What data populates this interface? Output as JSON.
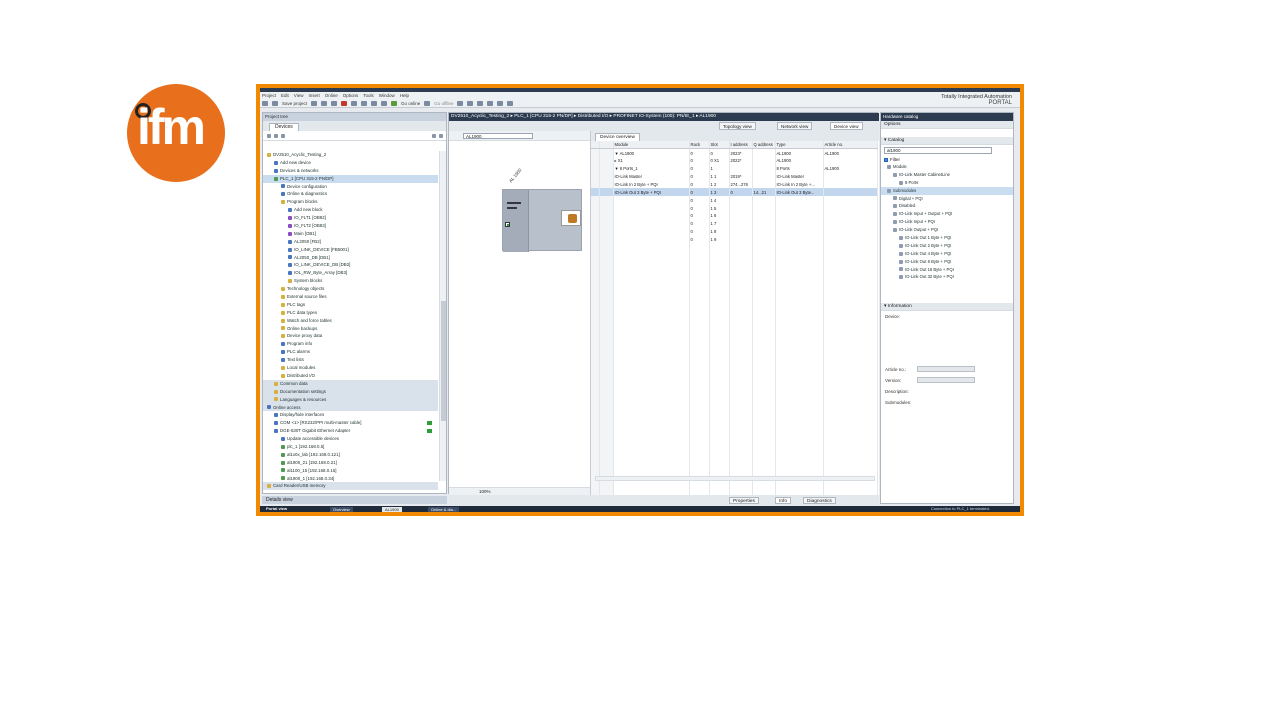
{
  "logo": {
    "text": "ifm"
  },
  "app": {
    "menus": [
      "Project",
      "Edit",
      "View",
      "Insert",
      "Online",
      "Options",
      "Tools",
      "Window",
      "Help"
    ],
    "toolbar": {
      "save_label": "Save project",
      "go_online": "Go online",
      "go_offline": "Go offline"
    },
    "brand_line1": "Totally Integrated Automation",
    "brand_line2": "PORTAL"
  },
  "project_tree": {
    "title": "Project tree",
    "tab": "Devices",
    "items": [
      {
        "label": "DV2510_Acyclic_Testing_2",
        "depth": 0,
        "icon": "f"
      },
      {
        "label": "Add new device",
        "depth": 1,
        "icon": "b"
      },
      {
        "label": "Devices & networks",
        "depth": 1,
        "icon": "b"
      },
      {
        "label": "PLC_1 [CPU 315-2 PN/DP]",
        "depth": 1,
        "icon": "g",
        "selected": true
      },
      {
        "label": "Device configuration",
        "depth": 2,
        "icon": "b"
      },
      {
        "label": "Online & diagnostics",
        "depth": 2,
        "icon": "b"
      },
      {
        "label": "Program blocks",
        "depth": 2,
        "icon": "f"
      },
      {
        "label": "Add new block",
        "depth": 3,
        "icon": "b"
      },
      {
        "label": "IO_FLT1 [OB82]",
        "depth": 3,
        "icon": "p"
      },
      {
        "label": "IO_FLT2 [OB83]",
        "depth": 3,
        "icon": "p"
      },
      {
        "label": "Main [OB1]",
        "depth": 3,
        "icon": "p"
      },
      {
        "label": "AL2050 [FB2]",
        "depth": 3,
        "icon": "b"
      },
      {
        "label": "IO_LINK_DEVICE [FB5001]",
        "depth": 3,
        "icon": "b"
      },
      {
        "label": "AL2050_DB [DB1]",
        "depth": 3,
        "icon": "b"
      },
      {
        "label": "IO_LINK_DEVICE_DB [DB2]",
        "depth": 3,
        "icon": "b"
      },
      {
        "label": "IOL_RW_Byte_Array [DB3]",
        "depth": 3,
        "icon": "b"
      },
      {
        "label": "System blocks",
        "depth": 3,
        "icon": "f"
      },
      {
        "label": "Technology objects",
        "depth": 2,
        "icon": "f"
      },
      {
        "label": "External source files",
        "depth": 2,
        "icon": "f"
      },
      {
        "label": "PLC tags",
        "depth": 2,
        "icon": "f"
      },
      {
        "label": "PLC data types",
        "depth": 2,
        "icon": "f"
      },
      {
        "label": "Watch and force tables",
        "depth": 2,
        "icon": "f"
      },
      {
        "label": "Online backups",
        "depth": 2,
        "icon": "f"
      },
      {
        "label": "Device proxy data",
        "depth": 2,
        "icon": "f"
      },
      {
        "label": "Program info",
        "depth": 2,
        "icon": "b"
      },
      {
        "label": "PLC alarms",
        "depth": 2,
        "icon": "b"
      },
      {
        "label": "Text lists",
        "depth": 2,
        "icon": "b"
      },
      {
        "label": "Local modules",
        "depth": 2,
        "icon": "f"
      },
      {
        "label": "Distributed I/O",
        "depth": 2,
        "icon": "f"
      },
      {
        "label": "Common data",
        "depth": 1,
        "icon": "f",
        "header": true
      },
      {
        "label": "Documentation settings",
        "depth": 1,
        "icon": "f",
        "header": true
      },
      {
        "label": "Languages & resources",
        "depth": 1,
        "icon": "f",
        "header": true
      },
      {
        "label": "Online access",
        "depth": 0,
        "icon": "b",
        "header": true
      },
      {
        "label": "Display/hide interfaces",
        "depth": 1,
        "icon": "b"
      },
      {
        "label": "COM <1> [RS232/PPI multi-master cable]",
        "depth": 1,
        "icon": "b",
        "status": true
      },
      {
        "label": "DGE-530T Gigabit Ethernet Adapter",
        "depth": 1,
        "icon": "b",
        "status": true
      },
      {
        "label": "Update accessible devices",
        "depth": 2,
        "icon": "b"
      },
      {
        "label": "plc_1 [192.168.0.5]",
        "depth": 2,
        "icon": "g"
      },
      {
        "label": "al1x0x_lab [192.168.0.121]",
        "depth": 2,
        "icon": "g"
      },
      {
        "label": "al1900_21 [192.168.0.21]",
        "depth": 2,
        "icon": "g"
      },
      {
        "label": "al1100_15 [192.168.0.15]",
        "depth": 2,
        "icon": "g"
      },
      {
        "label": "al1900_1 [192.168.0.34]",
        "depth": 2,
        "icon": "g"
      },
      {
        "label": "Card Reader/USB memory",
        "depth": 0,
        "icon": "f",
        "header": true
      }
    ],
    "details_view": "Details view"
  },
  "editor": {
    "breadcrumb": "DV2510_Acyclic_Testing_2 ▸ PLC_1 [CPU 315-2 PN/DP] ▸ Distributed I/O ▸ PROFINET IO-System (100): PN/IE_1 ▸ AL1900",
    "views": [
      "Topology view",
      "Network view",
      "Device view"
    ],
    "device_select": "AL1900",
    "device_label": "AL 1900",
    "zoom": "100%",
    "overview_tab": "Device overview",
    "columns": [
      "",
      "",
      "Module",
      "Rack",
      "Slot",
      "I address",
      "Q address",
      "Type",
      "Article no."
    ],
    "rows": [
      {
        "module": "▼ AL1900",
        "rack": "0",
        "slot": "0",
        "i": "2023*",
        "q": "",
        "type": "AL1900",
        "art": "AL1900"
      },
      {
        "module": "   ▸ X1",
        "rack": "0",
        "slot": "0 X1",
        "i": "2022*",
        "q": "",
        "type": "AL1900",
        "art": ""
      },
      {
        "module": "▼ 8 Ports_1",
        "rack": "0",
        "slot": "1",
        "i": "",
        "q": "",
        "type": "8 Ports",
        "art": "AL1900"
      },
      {
        "module": "   IO-Link Master",
        "rack": "0",
        "slot": "1 1",
        "i": "2019*",
        "q": "",
        "type": "IO-Link Master",
        "art": ""
      },
      {
        "module": "   IO-Link In  2 Byte + PQI",
        "rack": "0",
        "slot": "1 2",
        "i": "274...276",
        "q": "",
        "type": "IO-Link In  2 Byte +...",
        "art": ""
      },
      {
        "module": "   IO-Link Out 3 Byte + PQI",
        "rack": "0",
        "slot": "1 3",
        "i": "0",
        "q": "14...21",
        "type": "IO-Link Out 3 Byte...",
        "art": "",
        "selected": true
      },
      {
        "module": "",
        "rack": "0",
        "slot": "1 4",
        "i": "",
        "q": "",
        "type": "",
        "art": ""
      },
      {
        "module": "",
        "rack": "0",
        "slot": "1 5",
        "i": "",
        "q": "",
        "type": "",
        "art": ""
      },
      {
        "module": "",
        "rack": "0",
        "slot": "1 6",
        "i": "",
        "q": "",
        "type": "",
        "art": ""
      },
      {
        "module": "",
        "rack": "0",
        "slot": "1 7",
        "i": "",
        "q": "",
        "type": "",
        "art": ""
      },
      {
        "module": "",
        "rack": "0",
        "slot": "1 8",
        "i": "",
        "q": "",
        "type": "",
        "art": ""
      },
      {
        "module": "",
        "rack": "0",
        "slot": "1 9",
        "i": "",
        "q": "",
        "type": "",
        "art": ""
      }
    ],
    "info_tabs": [
      "Properties",
      "Info",
      "Diagnostics"
    ]
  },
  "catalog": {
    "title": "Hardware catalog",
    "options": "Options",
    "section": "Catalog",
    "search_value": "al1900",
    "filter": "Filter",
    "items": [
      {
        "label": "Module",
        "depth": 0
      },
      {
        "label": "IO-Link Master CabinetLine",
        "depth": 1
      },
      {
        "label": "8 Ports",
        "depth": 2
      },
      {
        "label": "Submodules",
        "depth": 0,
        "selected": true
      },
      {
        "label": "Digital + PQI",
        "depth": 1
      },
      {
        "label": "Disabled",
        "depth": 1
      },
      {
        "label": "IO-Link Input + Output + PQI",
        "depth": 1
      },
      {
        "label": "IO-Link Input + PQI",
        "depth": 1
      },
      {
        "label": "IO-Link Output + PQI",
        "depth": 1
      },
      {
        "label": "IO-Link Out  1 Byte + PQI",
        "depth": 2
      },
      {
        "label": "IO-Link Out  2 Byte + PQI",
        "depth": 2
      },
      {
        "label": "IO-Link Out  4 Byte + PQI",
        "depth": 2
      },
      {
        "label": "IO-Link Out  8 Byte + PQI",
        "depth": 2
      },
      {
        "label": "IO-Link Out 16 Byte + PQI",
        "depth": 2
      },
      {
        "label": "IO-Link Out 32 Byte + PQI",
        "depth": 2
      }
    ],
    "info_section": "Information",
    "device_label": "Device:",
    "article_label": "Article no.:",
    "version_label": "Version:",
    "description_label": "Description:",
    "submodules_label": "Submodules:"
  },
  "taskbar": {
    "portal_view": "Portal view",
    "tabs": [
      "Overview",
      "AL1900",
      "Online & dia..."
    ],
    "connection": "Connection to PLC_1 terminated."
  }
}
